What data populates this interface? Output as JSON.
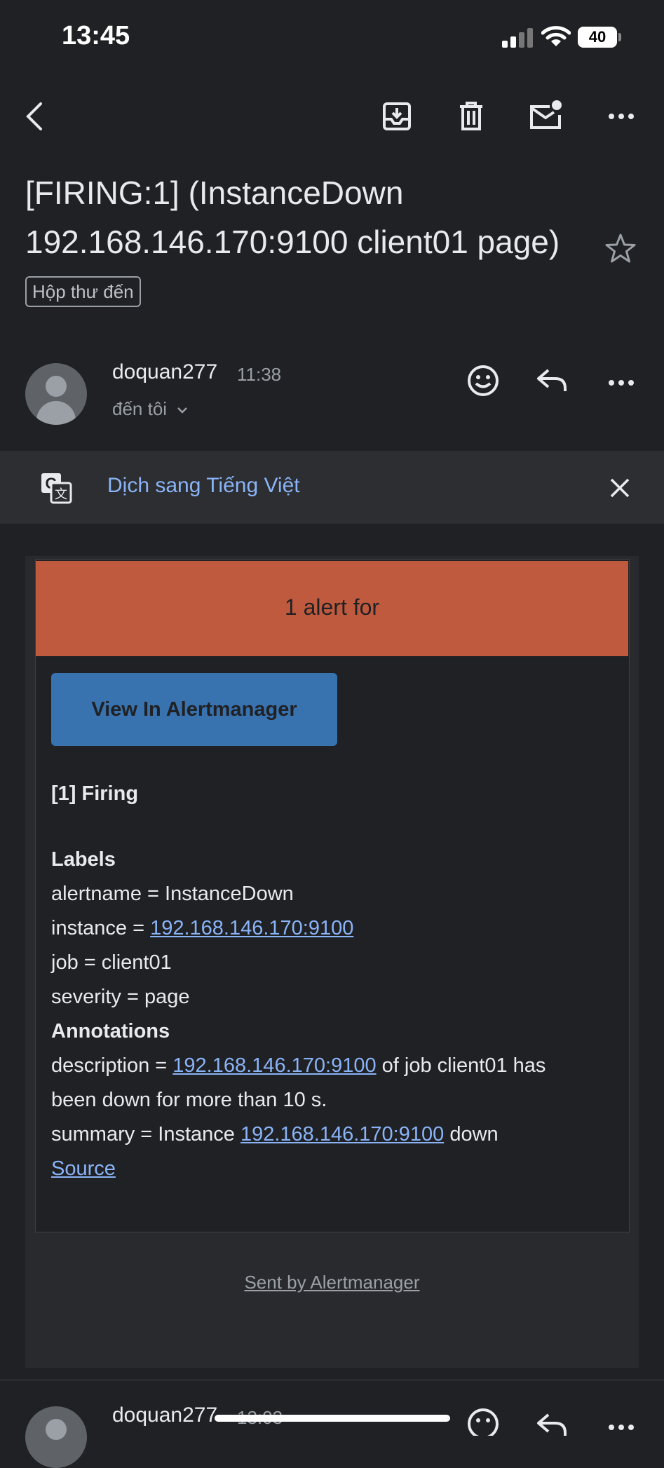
{
  "status_bar": {
    "time": "13:45",
    "battery": "40"
  },
  "toolbar": {
    "icons": [
      "back-arrow-icon",
      "archive-icon",
      "delete-icon",
      "mark-unread-icon",
      "more-icon"
    ]
  },
  "email": {
    "subject": "[FIRING:1]  (InstanceDown 192.168.146.170:9100 client01 page)",
    "label_chip": "Hộp thư đến",
    "sender": "doquan277",
    "time": "11:38",
    "recipient": "đến tôi"
  },
  "translate_bar": {
    "link": "Dịch sang Tiếng Việt"
  },
  "alert": {
    "header": "1 alert for",
    "button": "View In Alertmanager",
    "firing": "[1] Firing",
    "labels_heading": "Labels",
    "alertname_line": "alertname = InstanceDown",
    "instance_prefix": "instance = ",
    "instance_link": "192.168.146.170:9100",
    "job_line": "job = client01",
    "severity_line": "severity = page",
    "annotations_heading": "Annotations",
    "description_prefix": "description = ",
    "description_link": "192.168.146.170:9100",
    "description_suffix": " of job client01 has",
    "description_line2": "been down for more than 10 s.",
    "summary_prefix": "summary = Instance ",
    "summary_link": "192.168.146.170:9100",
    "summary_suffix": " down",
    "source_link": "Source",
    "footer": "Sent by Alertmanager"
  },
  "next_message": {
    "sender": "doquan277",
    "time": "13:03"
  },
  "colors": {
    "background": "#202124",
    "alert_header": "#c05a3e",
    "button": "#3873b0",
    "link": "#8ab4f8"
  }
}
